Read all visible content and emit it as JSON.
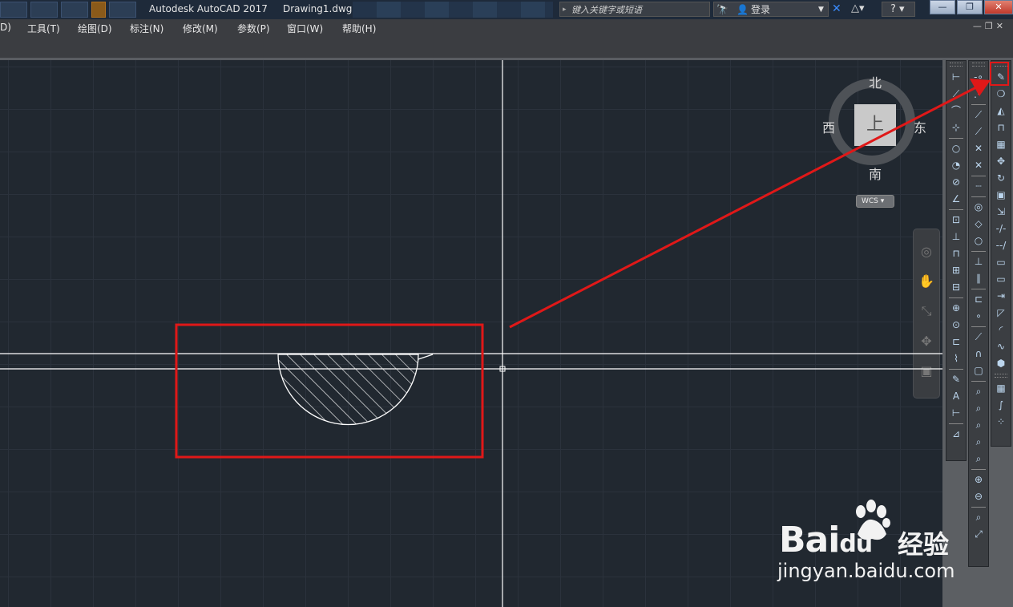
{
  "window": {
    "title": "Autodesk AutoCAD 2017",
    "document": "Drawing1.dwg"
  },
  "header": {
    "search_placeholder": "键入关键字或短语",
    "login_label": "登录",
    "help_icon": "?"
  },
  "menu": {
    "items": [
      "D)",
      "工具(T)",
      "绘图(D)",
      "标注(N)",
      "修改(M)",
      "参数(P)",
      "窗口(W)",
      "帮助(H)"
    ]
  },
  "viewcube": {
    "north": "北",
    "south": "南",
    "east": "东",
    "west": "西",
    "face": "上",
    "wcs_label": "WCS"
  },
  "watermark": {
    "logo": "Bai",
    "logo_tail": "du",
    "brand_cn": "经验",
    "url": "jingyan.baidu.com"
  },
  "colors": {
    "canvas_bg": "#212830",
    "annotation_red": "#e01818",
    "crosshair": "#ffffff"
  }
}
